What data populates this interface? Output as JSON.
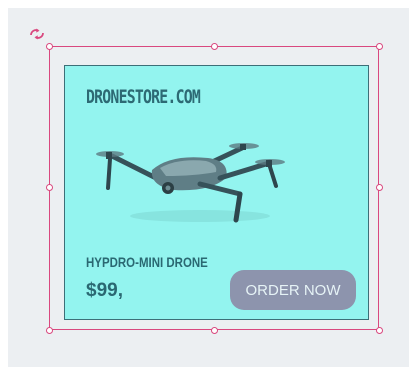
{
  "ad": {
    "brand": "DRONESTORE.COM",
    "product_name": "HYPDRO-MINI DRONE",
    "price": "$99,",
    "cta_label": "ORDER NOW"
  },
  "colors": {
    "card_background": "#93f4ef",
    "text": "#2a6872",
    "button_background": "#8d94ad",
    "selection_outline": "#d9487f",
    "canvas_background": "#eceff2"
  },
  "icons": {
    "rotate": "rotate-icon",
    "product_image": "drone-image"
  }
}
